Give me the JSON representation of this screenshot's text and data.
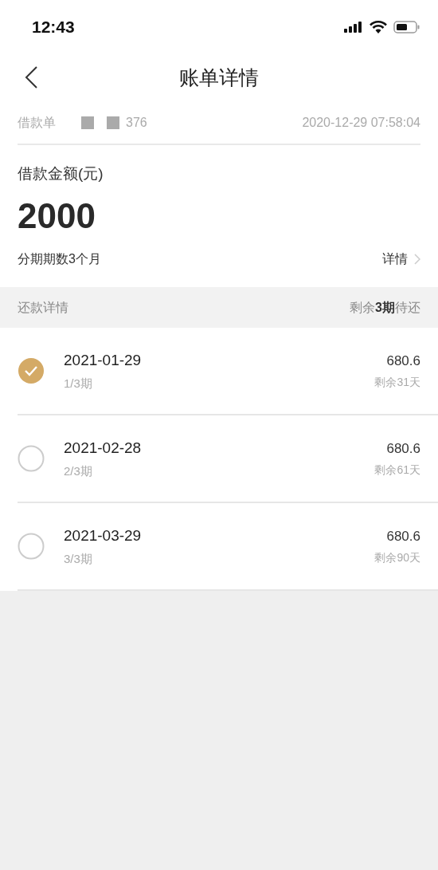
{
  "status_bar": {
    "time": "12:43"
  },
  "nav": {
    "title": "账单详情"
  },
  "loan": {
    "number_label": "借款单",
    "number_tail": "376",
    "created": "2020-12-29 07:58:04",
    "amount_label": "借款金额(元)",
    "amount": "2000",
    "term": "分期期数3个月",
    "detail_link": "详情"
  },
  "repayment": {
    "header": "还款详情",
    "remaining": "剩余**3期**待还",
    "installments": [
      {
        "date": "2021-01-29",
        "period": "1/3期",
        "amount": "680.6",
        "days_left": "剩余31天",
        "checked": true
      },
      {
        "date": "2021-02-28",
        "period": "2/3期",
        "amount": "680.6",
        "days_left": "剩余61天",
        "checked": false
      },
      {
        "date": "2021-03-29",
        "period": "3/3期",
        "amount": "680.6",
        "days_left": "剩余90天",
        "checked": false
      }
    ]
  }
}
